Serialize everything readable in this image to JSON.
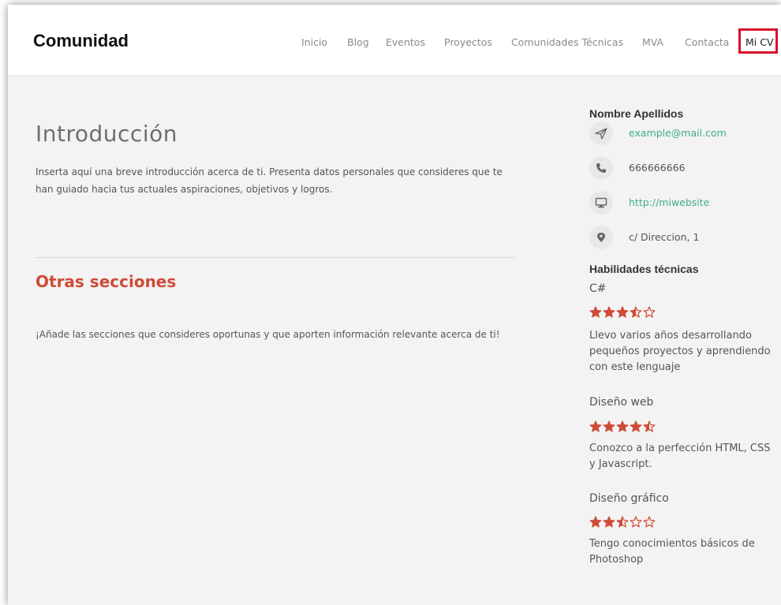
{
  "header": {
    "brand": "Comunidad",
    "nav": [
      {
        "label": "Inicio",
        "active": false
      },
      {
        "label": "Blog",
        "active": false
      },
      {
        "label": "Eventos",
        "active": false
      },
      {
        "label": "Proyectos",
        "active": false
      },
      {
        "label": "Comunidades Técnicas",
        "active": false
      },
      {
        "label": "MVA",
        "active": false
      },
      {
        "label": "Contacta",
        "active": false
      },
      {
        "label": "Mi CV",
        "active": true
      }
    ],
    "highlight_color": "#d7102a"
  },
  "main": {
    "intro_title": "Introducción",
    "intro_text": "Inserta aquí una breve introducción acerca de ti. Presenta datos personales que consideres que te han guiado hacia tus actuales aspiraciones, objetivos y logros.",
    "other_title": "Otras secciones",
    "other_text": "¡Añade las secciones que consideres oportunas y que aporten información relevante acerca de ti!"
  },
  "sidebar": {
    "name": "Nombre Apellidos",
    "contact": [
      {
        "icon": "paper-plane-icon",
        "text": "example@mail.com",
        "link": true
      },
      {
        "icon": "phone-icon",
        "text": "666666666",
        "link": false
      },
      {
        "icon": "monitor-icon",
        "text": "http://miwebsite",
        "link": true
      },
      {
        "icon": "map-marker-icon",
        "text": "c/ Direccion, 1",
        "link": false
      }
    ],
    "skills_title": "Habilidades técnicas",
    "skills": [
      {
        "name": "C#",
        "rating": 3.5,
        "max": 5,
        "description": "Llevo varios años desarrollando pequeños proyectos y aprendiendo con este lenguaje"
      },
      {
        "name": "Diseño web",
        "rating": 4.5,
        "max": 5,
        "description": "Conozco a la perfección HTML, CSS y Javascript."
      },
      {
        "name": "Diseño gráfico",
        "rating": 2.5,
        "max": 5,
        "description": "Tengo conocimientos básicos de Photoshop"
      }
    ]
  },
  "colors": {
    "accent_red": "#cf4b37",
    "link_green": "#3fae85",
    "background": "#f3f3f3"
  }
}
